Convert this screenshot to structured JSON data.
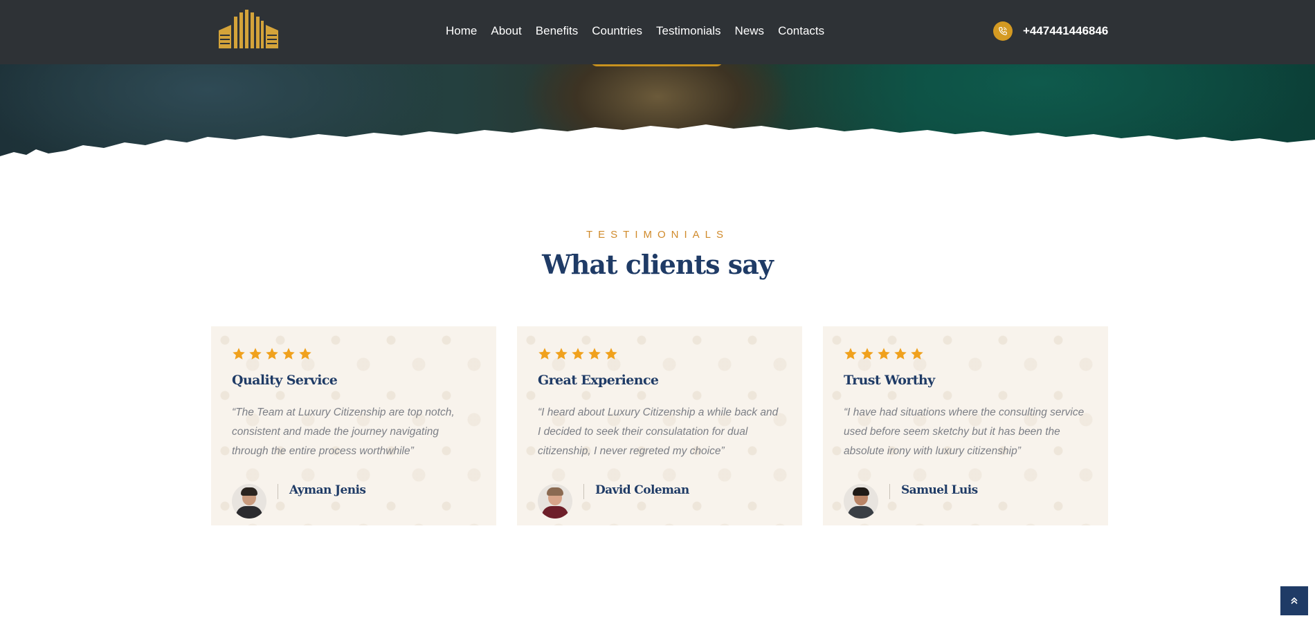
{
  "header": {
    "nav": [
      "Home",
      "About",
      "Benefits",
      "Countries",
      "Testimonials",
      "News",
      "Contacts"
    ],
    "phone": "+447441446846"
  },
  "section": {
    "eyebrow": "TESTIMONIALS",
    "title": "What clients say"
  },
  "testimonials": [
    {
      "rating": 5,
      "title": "Quality Service",
      "quote": "“The Team at Luxury Citizenship are top notch, consistent and made the journey navigating through the entire process worthwhile”",
      "author": "Ayman Jenis"
    },
    {
      "rating": 5,
      "title": "Great Experience",
      "quote": "“I heard about Luxury Citizenship a while back and I decided to seek their consulatation for dual citizenship, I never regreted my choice”",
      "author": "David Coleman"
    },
    {
      "rating": 5,
      "title": "Trust Worthy",
      "quote": "“I have had situations where the consulting service used before seem sketchy but it has been the absolute irony with luxury citizenship”",
      "author": "Samuel Luis"
    }
  ],
  "colors": {
    "header_bg": "#2e3236",
    "accent_gold": "#d49a22",
    "star": "#f0a11d",
    "navy": "#1f3b66",
    "eyebrow": "#d08a2a",
    "card_bg": "#f8f3ec"
  },
  "icons": {
    "logo": "building-logo",
    "phone": "phone-icon",
    "star": "star-icon",
    "scroll_top": "double-chevron-up-icon"
  }
}
